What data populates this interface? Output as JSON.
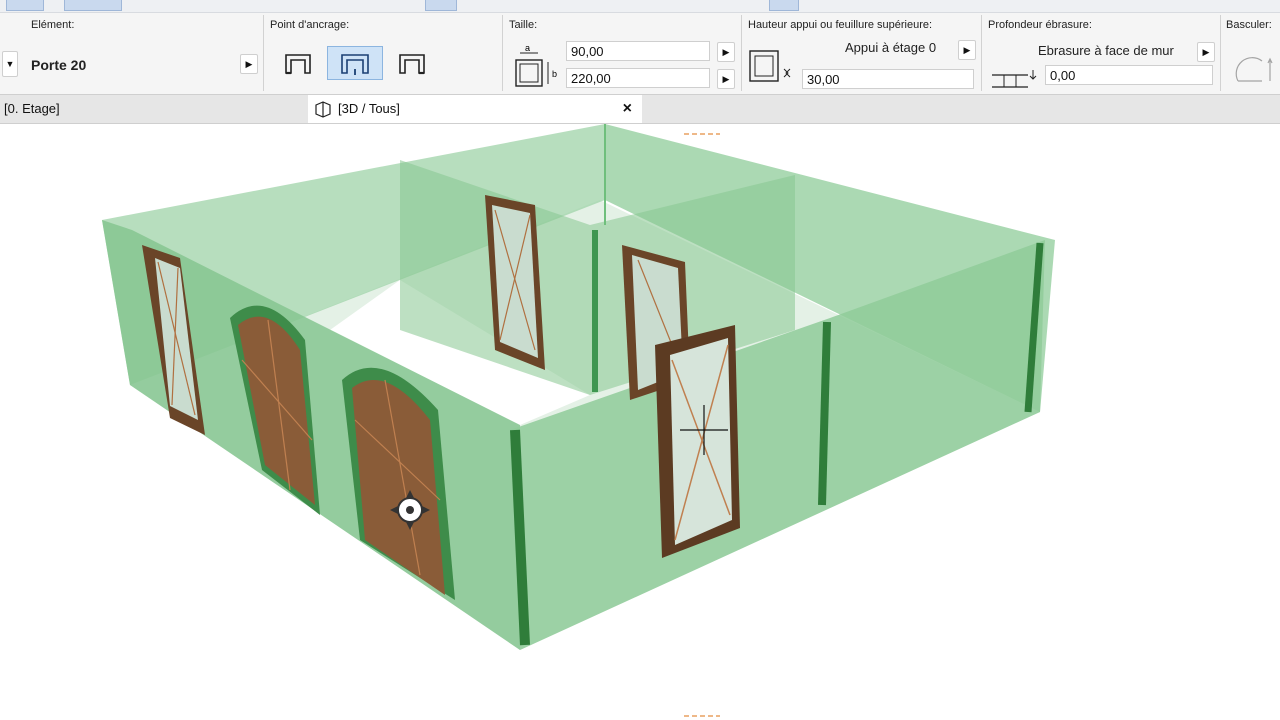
{
  "toolbar": {
    "strip": "partial toolbar icons row"
  },
  "infobox": {
    "element_label": "Elément:",
    "element_value": "Porte 20",
    "anchor_label": "Point d'ancrage:",
    "size_label": "Taille:",
    "size_a_value": "90,00",
    "size_b_value": "220,00",
    "size_a_tag": "a",
    "size_b_tag": "b",
    "sill_label": "Hauteur appui ou feuillure supérieure:",
    "sill_mode": "Appui à étage 0",
    "sill_value": "30,00",
    "reveal_label": "Profondeur ébrasure:",
    "reveal_mode": "Ebrasure à face de mur",
    "reveal_value": "0,00",
    "flip_label": "Basculer:"
  },
  "tabs": {
    "inactive_label": "[0. Etage]",
    "active_label": "[3D / Tous]",
    "close_symbol": "×"
  },
  "icons": [
    "dropdown-arrow-icon",
    "chevron-right-icon",
    "anchor-left-icon",
    "anchor-center-icon",
    "anchor-right-icon",
    "size-icon",
    "sill-icon",
    "reveal-icon",
    "flip-icon",
    "3d-view-icon",
    "close-icon",
    "transform-cursor-icon"
  ],
  "colors": {
    "wall_fill": "#86c690",
    "wall_edge": "#3a8a45",
    "door_wood": "#7a5230",
    "selection": "#cfe3f7"
  }
}
